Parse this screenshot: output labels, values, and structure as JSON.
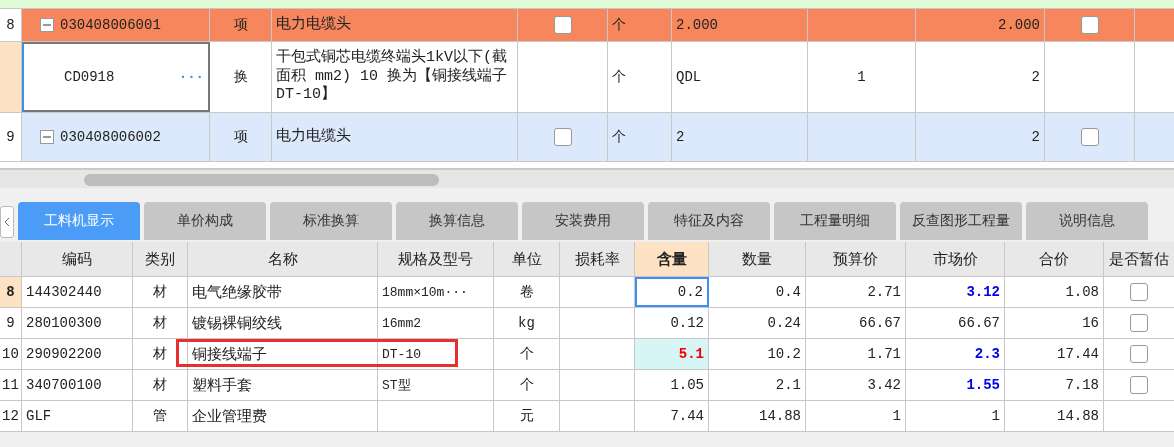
{
  "upper_table": {
    "rows": [
      {
        "kind": "stub"
      },
      {
        "kind": "item",
        "selected": true,
        "num": "8",
        "code": "030408006001",
        "type": "项",
        "name": "电力电缆头",
        "checked": false,
        "unit": "个",
        "expr": "2.000",
        "factor": "",
        "qty": "2.000",
        "flag_checked": false
      },
      {
        "kind": "sub",
        "num": "",
        "code": "CD0918",
        "more": "···",
        "type": "换",
        "name": "干包式铜芯电缆终端头1kV以下(截面积 mm2) 10  换为【铜接线端子DT-10】",
        "unit": "个",
        "expr": "QDL",
        "factor": "1",
        "qty": "2"
      },
      {
        "kind": "item",
        "selected": false,
        "num": "9",
        "code": "030408006002",
        "type": "项",
        "name": "电力电缆头",
        "checked": false,
        "unit": "个",
        "expr": "2",
        "factor": "",
        "qty": "2",
        "flag_checked": false
      },
      {
        "kind": "stub"
      }
    ]
  },
  "tabs": [
    {
      "label": "工料机显示",
      "selected": true
    },
    {
      "label": "单价构成",
      "selected": false
    },
    {
      "label": "标准换算",
      "selected": false
    },
    {
      "label": "换算信息",
      "selected": false
    },
    {
      "label": "安装费用",
      "selected": false
    },
    {
      "label": "特征及内容",
      "selected": false
    },
    {
      "label": "工程量明细",
      "selected": false
    },
    {
      "label": "反查图形工程量",
      "selected": false
    },
    {
      "label": "说明信息",
      "selected": false
    }
  ],
  "lower_table": {
    "columns": [
      "编码",
      "类别",
      "名称",
      "规格及型号",
      "单位",
      "损耗率",
      "含量",
      "数量",
      "预算价",
      "市场价",
      "合价",
      "是否暂估"
    ],
    "rows": [
      {
        "num": "8",
        "selected": true,
        "code": "144302440",
        "cat": "材",
        "name": "电气绝缘胶带",
        "spec": "18mm×10m···",
        "unit": "卷",
        "loss": "",
        "content": "0.2",
        "content_changed": false,
        "qty": "0.4",
        "budget": "2.71",
        "market": "3.12",
        "market_modified": true,
        "total": "1.08",
        "estimate_checked": false
      },
      {
        "num": "9",
        "selected": false,
        "code": "280100300",
        "cat": "材",
        "name": "镀锡裸铜绞线",
        "spec": "16mm2",
        "unit": "kg",
        "loss": "",
        "content": "0.12",
        "content_changed": false,
        "qty": "0.24",
        "budget": "66.67",
        "market": "66.67",
        "market_modified": false,
        "total": "16",
        "estimate_checked": false
      },
      {
        "num": "10",
        "selected": false,
        "code": "290902200",
        "cat": "材",
        "name": "铜接线端子",
        "spec": "DT-10",
        "unit": "个",
        "loss": "",
        "content": "5.1",
        "content_changed": true,
        "qty": "10.2",
        "budget": "1.71",
        "market": "2.3",
        "market_modified": true,
        "total": "17.44",
        "estimate_checked": false,
        "highlighted": true
      },
      {
        "num": "11",
        "selected": false,
        "code": "340700100",
        "cat": "材",
        "name": "塑料手套",
        "spec": "ST型",
        "unit": "个",
        "loss": "",
        "content": "1.05",
        "content_changed": false,
        "qty": "2.1",
        "budget": "3.42",
        "market": "1.55",
        "market_modified": true,
        "total": "7.18",
        "estimate_checked": false
      },
      {
        "num": "12",
        "selected": false,
        "code": "GLF",
        "cat": "管",
        "name": "企业管理费",
        "spec": "",
        "unit": "元",
        "loss": "",
        "content": "7.44",
        "content_changed": false,
        "qty": "14.88",
        "budget": "1",
        "market": "1",
        "market_modified": false,
        "total": "14.88"
      }
    ]
  }
}
